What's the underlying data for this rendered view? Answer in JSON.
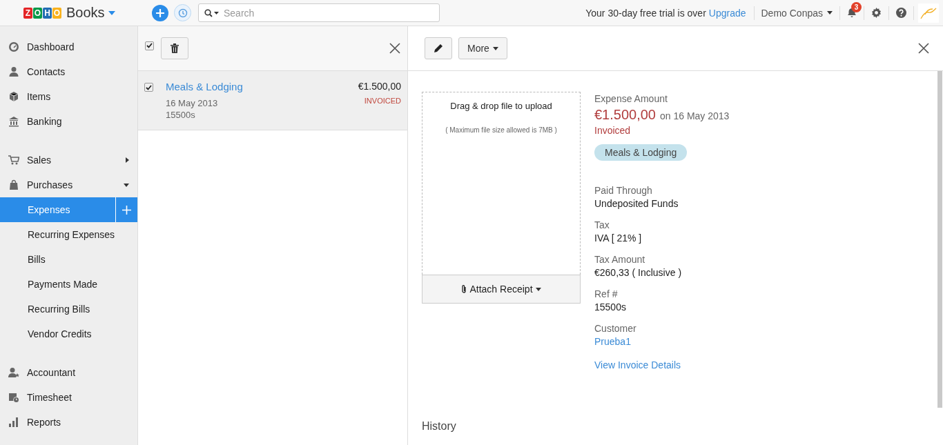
{
  "topbar": {
    "logo_letters": [
      "Z",
      "O",
      "H",
      "O"
    ],
    "product": "Books",
    "search": {
      "placeholder": "Search"
    },
    "trial_text": "Your 30-day free trial is over",
    "upgrade_link": "Upgrade",
    "organization": "Demo Conpas",
    "notification_count": "3"
  },
  "sidebar": {
    "sections": [
      [
        {
          "label": "Dashboard",
          "selected": false
        },
        {
          "label": "Contacts",
          "selected": false
        },
        {
          "label": "Items",
          "selected": false
        },
        {
          "label": "Banking",
          "selected": false
        }
      ],
      [
        {
          "label": "Sales",
          "selected": false,
          "expanded": false
        },
        {
          "label": "Purchases",
          "selected": false,
          "expanded": true,
          "children": [
            {
              "label": "Expenses",
              "selected": true,
              "add_button": true
            },
            {
              "label": "Recurring Expenses",
              "selected": false,
              "add_button": false
            },
            {
              "label": "Bills",
              "selected": false,
              "add_button": false
            },
            {
              "label": "Payments Made",
              "selected": false,
              "add_button": false
            },
            {
              "label": "Recurring Bills",
              "selected": false,
              "add_button": false
            },
            {
              "label": "Vendor Credits",
              "selected": false,
              "add_button": false
            }
          ]
        }
      ],
      [
        {
          "label": "Accountant",
          "selected": false
        },
        {
          "label": "Timesheet",
          "selected": false
        },
        {
          "label": "Reports",
          "selected": false
        }
      ]
    ]
  },
  "list": {
    "select_all_checked": true,
    "rows": [
      {
        "title": "Meals & Lodging",
        "date": "16 May 2013",
        "reference": "15500s",
        "amount": "€1.500,00",
        "status": "INVOICED",
        "checked": true,
        "selected": true
      }
    ]
  },
  "detail": {
    "toolbar": {
      "more_button": "More"
    },
    "upload": {
      "title": "Drag & drop file to upload",
      "hint": "( Maximum file size allowed is 7MB )",
      "attach_button": "Attach Receipt"
    },
    "amount_label": "Expense Amount",
    "amount": "€1.500,00",
    "date": "on 16 May 2013",
    "status": "Invoiced",
    "category_tag": "Meals & Lodging",
    "fields": [
      {
        "label": "Paid Through",
        "value": "Undeposited Funds",
        "kind": "text"
      },
      {
        "label": "Tax",
        "value": "IVA [ 21% ]",
        "kind": "text"
      },
      {
        "label": "Tax Amount",
        "value": "€260,33 ( Inclusive )",
        "kind": "text"
      },
      {
        "label": "Ref #",
        "value": "15500s",
        "kind": "text"
      },
      {
        "label": "Customer",
        "value": "Prueba1",
        "kind": "link"
      }
    ],
    "invoice_link": "View Invoice Details",
    "history_heading": "History"
  }
}
